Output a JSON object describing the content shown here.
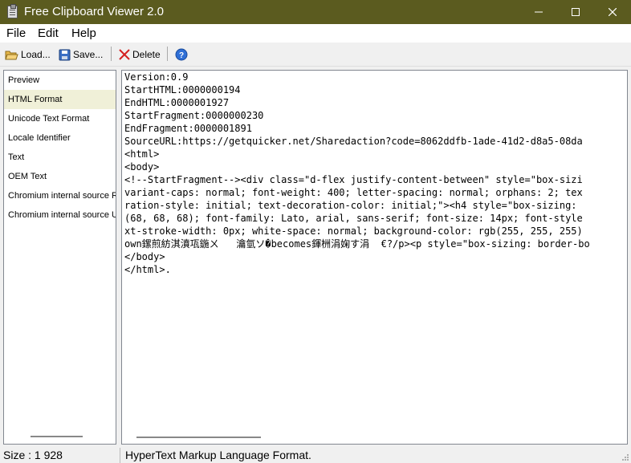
{
  "window": {
    "title": "Free Clipboard Viewer 2.0"
  },
  "menu": [
    "File",
    "Edit",
    "Help"
  ],
  "toolbar": {
    "load": "Load...",
    "save": "Save...",
    "delete": "Delete"
  },
  "formats": [
    "Preview",
    "HTML Format",
    "Unicode Text Format",
    "Locale Identifier",
    "Text",
    "OEM Text",
    "Chromium internal source RFH token",
    "Chromium internal source URL"
  ],
  "selected_format": "HTML Format",
  "content_lines": [
    "Version:0.9",
    "StartHTML:0000000194",
    "EndHTML:0000001927",
    "StartFragment:0000000230",
    "EndFragment:0000001891",
    "SourceURL:https://getquicker.net/Sharedaction?code=8062ddfb-1ade-41d2-d8a5-08da",
    "<html>",
    "<body>",
    "<!--StartFragment--><div class=\"d-flex justify-content-between\" style=\"box-sizi",
    "variant-caps: normal; font-weight: 400; letter-spacing: normal; orphans: 2; tex",
    "ration-style: initial; text-decoration-color: initial;\"><h4 style=\"box-sizing:",
    "(68, 68, 68); font-family: Lato, arial, sans-serif; font-size: 14px; font-style",
    "xt-stroke-width: 0px; white-space: normal; background-color: rgb(255, 255, 255)",
    "own鏍煎紡淇濆瓨鍦ㄨ   瀹氫ソ�becomes鍕栦涓婅す涓  €?/p><p style=\"box-sizing: border-bo",
    "</body>",
    "</html>."
  ],
  "status": {
    "size": "Size : 1 928",
    "description": "HyperText Markup Language Format."
  },
  "colors": {
    "titlebar": "#5b5b1f",
    "selected_row": "#f0f0d8"
  }
}
